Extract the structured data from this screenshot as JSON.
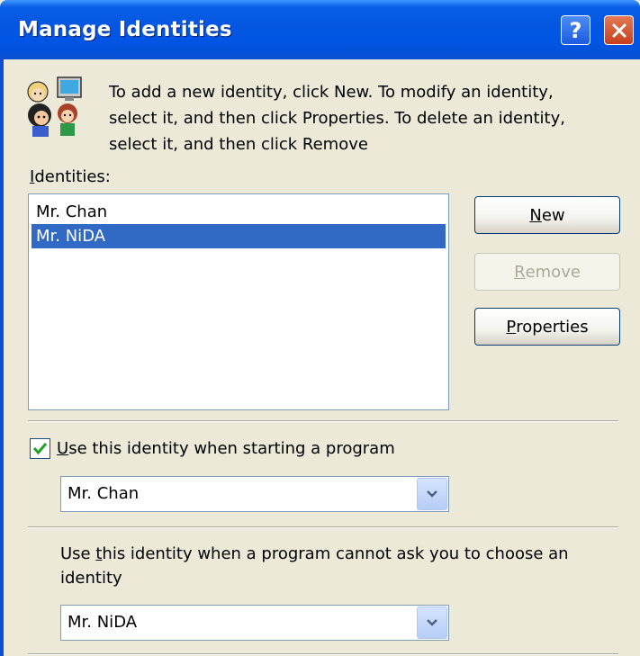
{
  "window": {
    "title": "Manage Identities",
    "help_icon": "help-icon",
    "close_icon": "close-icon"
  },
  "intro": {
    "icon": "identities-people-icon",
    "lines": [
      "To add a new identity, click New.  To modify an identity,",
      "select it, and then click Properties.  To delete an identity,",
      "select it, and then click Remove"
    ]
  },
  "identities": {
    "label_accel": "I",
    "label_rest": "dentities:",
    "items": [
      {
        "name": "Mr. Chan",
        "selected": false
      },
      {
        "name": "Mr. NiDA",
        "selected": true
      }
    ]
  },
  "buttons": {
    "new": {
      "accel": "N",
      "rest": "ew",
      "enabled": true
    },
    "remove": {
      "accel": "R",
      "rest": "emove",
      "enabled": false
    },
    "properties": {
      "accel": "P",
      "rest": "roperties",
      "enabled": true
    }
  },
  "startup": {
    "checked": true,
    "label_accel": "U",
    "label_rest": "se this identity when starting a program",
    "selected": "Mr. Chan"
  },
  "default_identity": {
    "label_pre": "Use ",
    "label_accel": "t",
    "label_rest_line1": "his identity when a program cannot ask you to choose an",
    "label_line2": "identity",
    "selected": "Mr. NiDA"
  },
  "colors": {
    "titlebar": "#0055e5",
    "selection": "#316ac5",
    "face": "#ece9d8",
    "close_button": "#c6401d"
  }
}
